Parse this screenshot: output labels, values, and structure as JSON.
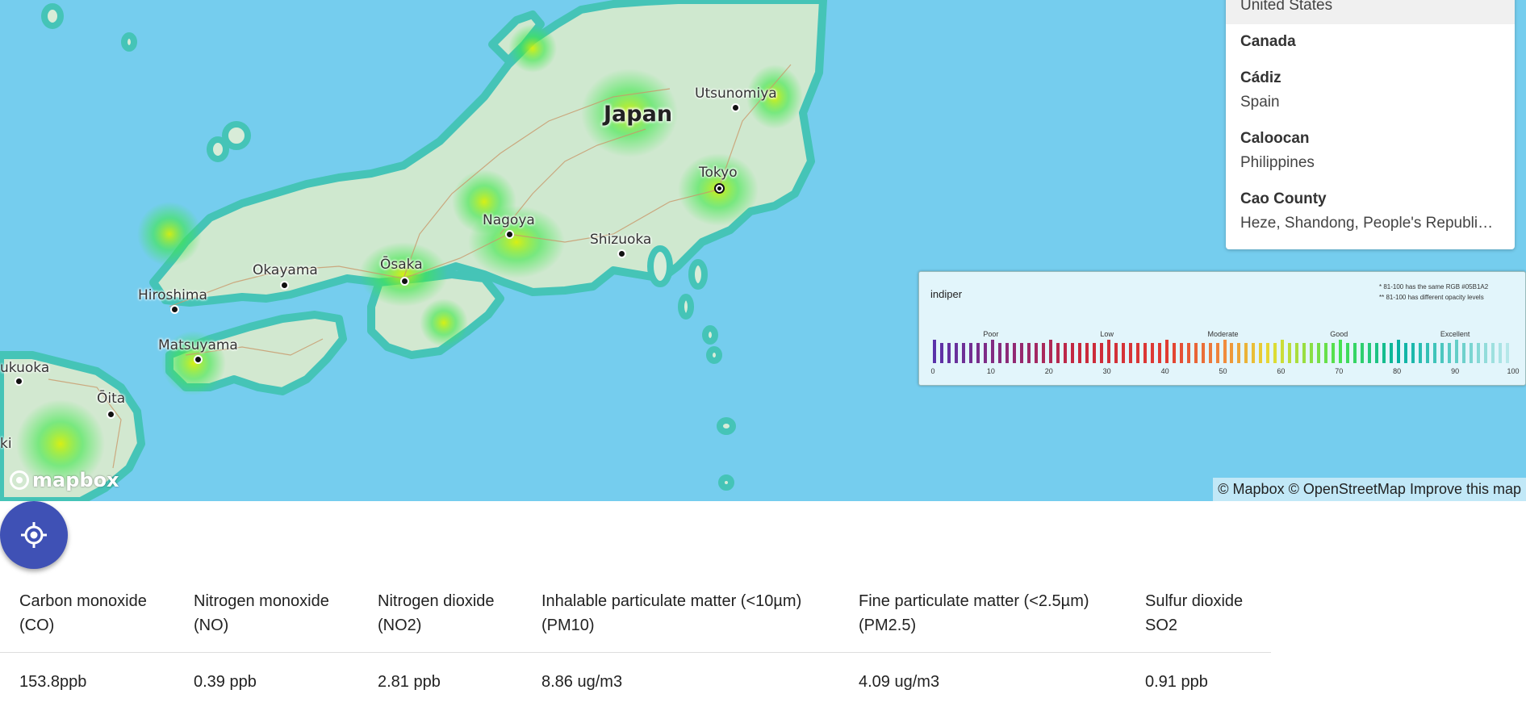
{
  "map": {
    "country_label": "Japan",
    "cities": [
      "Utsunomiya",
      "Tokyo",
      "Nagoya",
      "Shizuoka",
      "Ōsaka",
      "Okayama",
      "Hiroshima",
      "Matsuyama",
      "ukuoka",
      "Ōita",
      "ki"
    ],
    "capital": "Tokyo",
    "logo_text": "mapbox",
    "attribution": {
      "mapbox": "© Mapbox",
      "osm": "© OpenStreetMap",
      "improve": "Improve this map"
    },
    "colors": {
      "water": "#75cdee",
      "land": "#d8ecd8",
      "heat": "#3ee84a"
    }
  },
  "search_results": [
    {
      "name": "",
      "sub": "United States"
    },
    {
      "name": "Canada",
      "sub": ""
    },
    {
      "name": "Cádiz",
      "sub": "Spain"
    },
    {
      "name": "Caloocan",
      "sub": "Philippines"
    },
    {
      "name": "Cao County",
      "sub": "Heze, Shandong, People's Republic of China"
    }
  ],
  "legend": {
    "title": "indiper",
    "notes": [
      "* 81-100 has the same RGB #05B1A2",
      "** 81-100 has different opacity levels"
    ],
    "categories": [
      "Poor",
      "Low",
      "Moderate",
      "Good",
      "Excellent"
    ],
    "ticks": [
      "0",
      "10",
      "20",
      "30",
      "40",
      "50",
      "60",
      "70",
      "80",
      "90",
      "100"
    ]
  },
  "locate_button": {
    "icon": "crosshair-icon"
  },
  "pollutants": {
    "headers": [
      [
        "Carbon monoxide",
        "(CO)"
      ],
      [
        "Nitrogen monoxide",
        "(NO)"
      ],
      [
        "Nitrogen dioxide",
        "(NO2)"
      ],
      [
        "Inhalable particulate matter (<10µm)",
        "(PM10)"
      ],
      [
        "Fine particulate matter (<2.5µm)",
        "(PM2.5)"
      ],
      [
        "Sulfur dioxide",
        "SO2"
      ]
    ],
    "values": [
      "153.8ppb",
      "0.39 ppb",
      "2.81 ppb",
      "8.86 ug/m3",
      "4.09 ug/m3",
      "0.91 ppb"
    ]
  }
}
